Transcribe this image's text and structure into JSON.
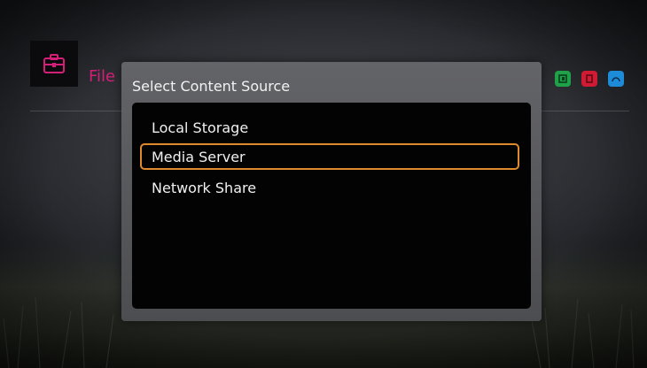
{
  "header": {
    "title": "File",
    "app_icon": "briefcase-icon",
    "buttons": [
      {
        "icon": "green-key-icon",
        "color": "#1fa14a"
      },
      {
        "icon": "red-key-icon",
        "color": "#d11a33"
      },
      {
        "icon": "blue-key-icon",
        "color": "#1d8bd8"
      }
    ]
  },
  "dialog": {
    "title": "Select Content Source",
    "options": [
      "Local Storage",
      "Media Server",
      "Network Share"
    ],
    "selected_option": "Media Server",
    "highlight_color": "#e08a2e"
  },
  "colors": {
    "brand_magenta": "#d41f79"
  }
}
